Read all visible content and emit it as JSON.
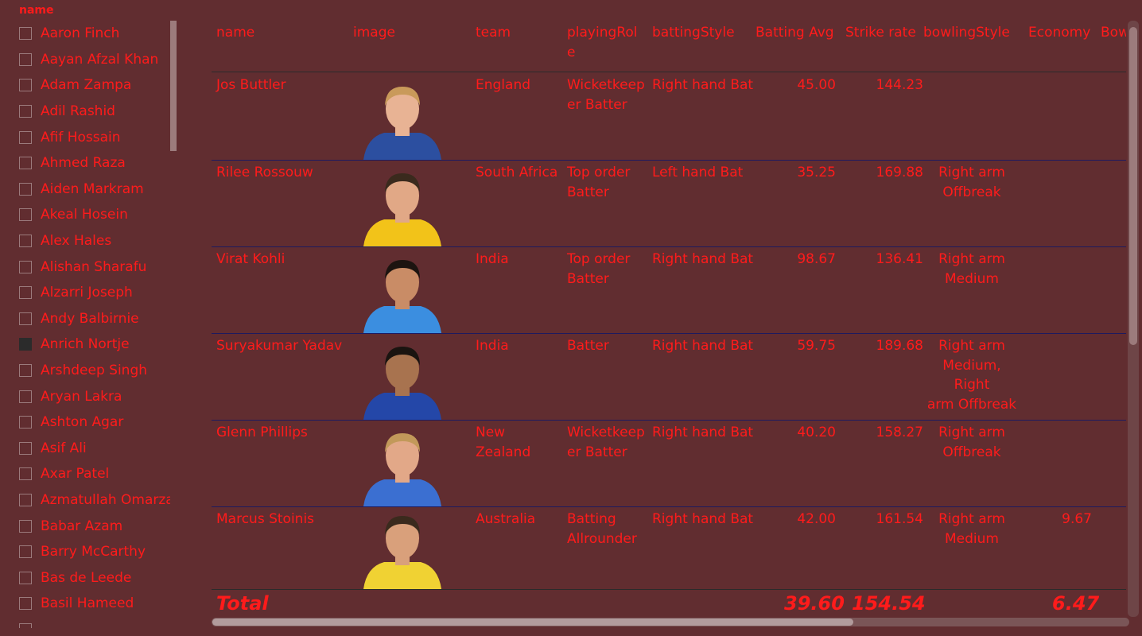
{
  "slicer": {
    "title": "name",
    "items": [
      {
        "label": "Aaron Finch",
        "checked": false
      },
      {
        "label": "Aayan Afzal Khan",
        "checked": false
      },
      {
        "label": "Adam Zampa",
        "checked": false
      },
      {
        "label": "Adil Rashid",
        "checked": false
      },
      {
        "label": "Afif Hossain",
        "checked": false
      },
      {
        "label": "Ahmed Raza",
        "checked": false
      },
      {
        "label": "Aiden Markram",
        "checked": false
      },
      {
        "label": "Akeal Hosein",
        "checked": false
      },
      {
        "label": "Alex Hales",
        "checked": false
      },
      {
        "label": "Alishan Sharafu",
        "checked": false
      },
      {
        "label": "Alzarri Joseph",
        "checked": false
      },
      {
        "label": "Andy Balbirnie",
        "checked": false
      },
      {
        "label": "Anrich Nortje",
        "checked": true
      },
      {
        "label": "Arshdeep Singh",
        "checked": false
      },
      {
        "label": "Aryan Lakra",
        "checked": false
      },
      {
        "label": "Ashton Agar",
        "checked": false
      },
      {
        "label": "Asif Ali",
        "checked": false
      },
      {
        "label": "Axar Patel",
        "checked": false
      },
      {
        "label": "Azmatullah Omarzai",
        "checked": false
      },
      {
        "label": "Babar Azam",
        "checked": false
      },
      {
        "label": "Barry McCarthy",
        "checked": false
      },
      {
        "label": "Bas de Leede",
        "checked": false
      },
      {
        "label": "Basil Hameed",
        "checked": false
      },
      {
        "label": "",
        "checked": false
      }
    ]
  },
  "table": {
    "headers": {
      "name": "name",
      "image": "image",
      "team": "team",
      "playingRole_1": "playingRol",
      "playingRole_2": "e",
      "battingStyle": "battingStyle",
      "battingAvg": "Batting Avg",
      "strikeRate": "Strike rate",
      "bowlingStyle": "bowlingStyle",
      "economy": "Economy",
      "bowl": "Bow"
    },
    "rows": [
      {
        "name": "Jos Buttler",
        "team": "England",
        "role": [
          "Wicketkeep",
          "er Batter"
        ],
        "batting": "Right hand Bat",
        "avg": "45.00",
        "sr": "144.23",
        "bowling": [],
        "economy": "",
        "jersey": "#2c4fa0",
        "skin": "#e8b394",
        "hair": "#c99a5a"
      },
      {
        "name": "Rilee Rossouw",
        "team": "South Africa",
        "role": [
          "Top order",
          "Batter"
        ],
        "batting": "Left hand Bat",
        "avg": "35.25",
        "sr": "169.88",
        "bowling": [
          "Right arm",
          "Offbreak"
        ],
        "economy": "",
        "jersey": "#f2c319",
        "skin": "#e1a886",
        "hair": "#3a2a1d"
      },
      {
        "name": "Virat Kohli",
        "team": "India",
        "role": [
          "Top order",
          "Batter"
        ],
        "batting": "Right hand Bat",
        "avg": "98.67",
        "sr": "136.41",
        "bowling": [
          "Right arm",
          "Medium"
        ],
        "economy": "",
        "jersey": "#3b8ee0",
        "skin": "#c98c66",
        "hair": "#1c1410"
      },
      {
        "name": "Suryakumar Yadav",
        "team": "India",
        "role": [
          "Batter"
        ],
        "batting": "Right hand Bat",
        "avg": "59.75",
        "sr": "189.68",
        "bowling": [
          "Right arm",
          "Medium, Right",
          "arm Offbreak"
        ],
        "economy": "",
        "jersey": "#2447a8",
        "skin": "#a8734f",
        "hair": "#1a1410"
      },
      {
        "name": "Glenn Phillips",
        "team": "New Zealand",
        "role": [
          "Wicketkeep",
          "er Batter"
        ],
        "batting": "Right hand Bat",
        "avg": "40.20",
        "sr": "158.27",
        "bowling": [
          "Right arm",
          "Offbreak"
        ],
        "economy": "",
        "jersey": "#3b6fd1",
        "skin": "#e2a888",
        "hair": "#c2995a"
      },
      {
        "name": "Marcus Stoinis",
        "team": "Australia",
        "role": [
          "Batting",
          "Allrounder"
        ],
        "batting": "Right hand Bat",
        "avg": "42.00",
        "sr": "161.54",
        "bowling": [
          "Right arm",
          "Medium"
        ],
        "economy": "9.67",
        "jersey": "#f0d233",
        "skin": "#d9a07b",
        "hair": "#3a2a1d"
      }
    ],
    "totals": {
      "label": "Total",
      "avg": "39.60",
      "sr": "154.54",
      "economy": "6.47"
    }
  }
}
